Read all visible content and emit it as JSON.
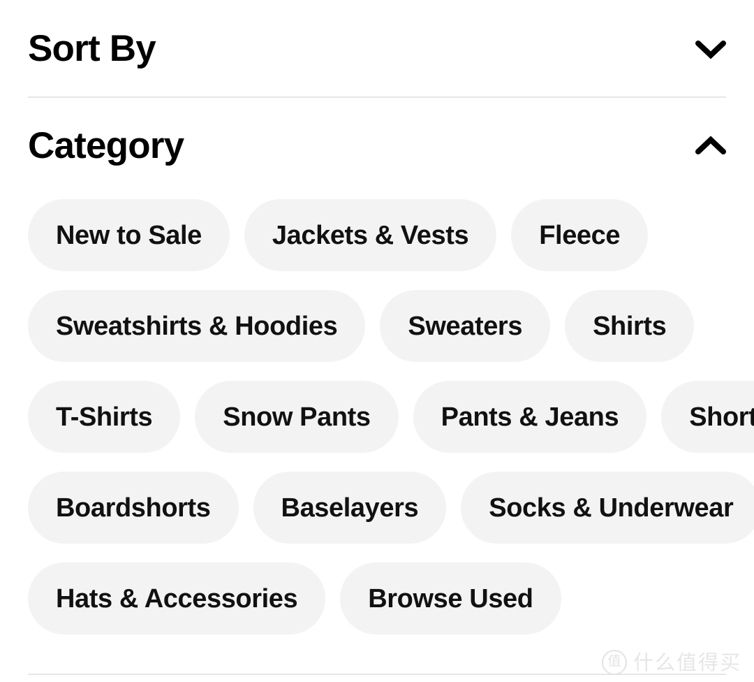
{
  "page": {
    "background_color": "#ffffff",
    "pill_background_color": "#f3f3f3",
    "text_color": "#000000",
    "divider_color": "#e6e6e6"
  },
  "filters": [
    {
      "id": "sort-by",
      "title": "Sort By",
      "expanded": false,
      "chevron": "chevron-down-icon"
    },
    {
      "id": "category",
      "title": "Category",
      "expanded": true,
      "chevron": "chevron-up-icon"
    }
  ],
  "category_options": {
    "rows": [
      [
        "New to Sale",
        "Jackets & Vests",
        "Fleece"
      ],
      [
        "Sweatshirts & Hoodies",
        "Sweaters",
        "Shirts"
      ],
      [
        "T-Shirts",
        "Snow Pants",
        "Pants & Jeans",
        "Shorts"
      ],
      [
        "Boardshorts",
        "Baselayers",
        "Socks & Underwear"
      ],
      [
        "Hats & Accessories",
        "Browse Used"
      ]
    ],
    "flat": [
      "New to Sale",
      "Jackets & Vests",
      "Fleece",
      "Sweatshirts & Hoodies",
      "Sweaters",
      "Shirts",
      "T-Shirts",
      "Snow Pants",
      "Pants & Jeans",
      "Shorts",
      "Boardshorts",
      "Baselayers",
      "Socks & Underwear",
      "Hats & Accessories",
      "Browse Used"
    ]
  },
  "watermark": {
    "badge": "值",
    "text": "什么值得买"
  }
}
